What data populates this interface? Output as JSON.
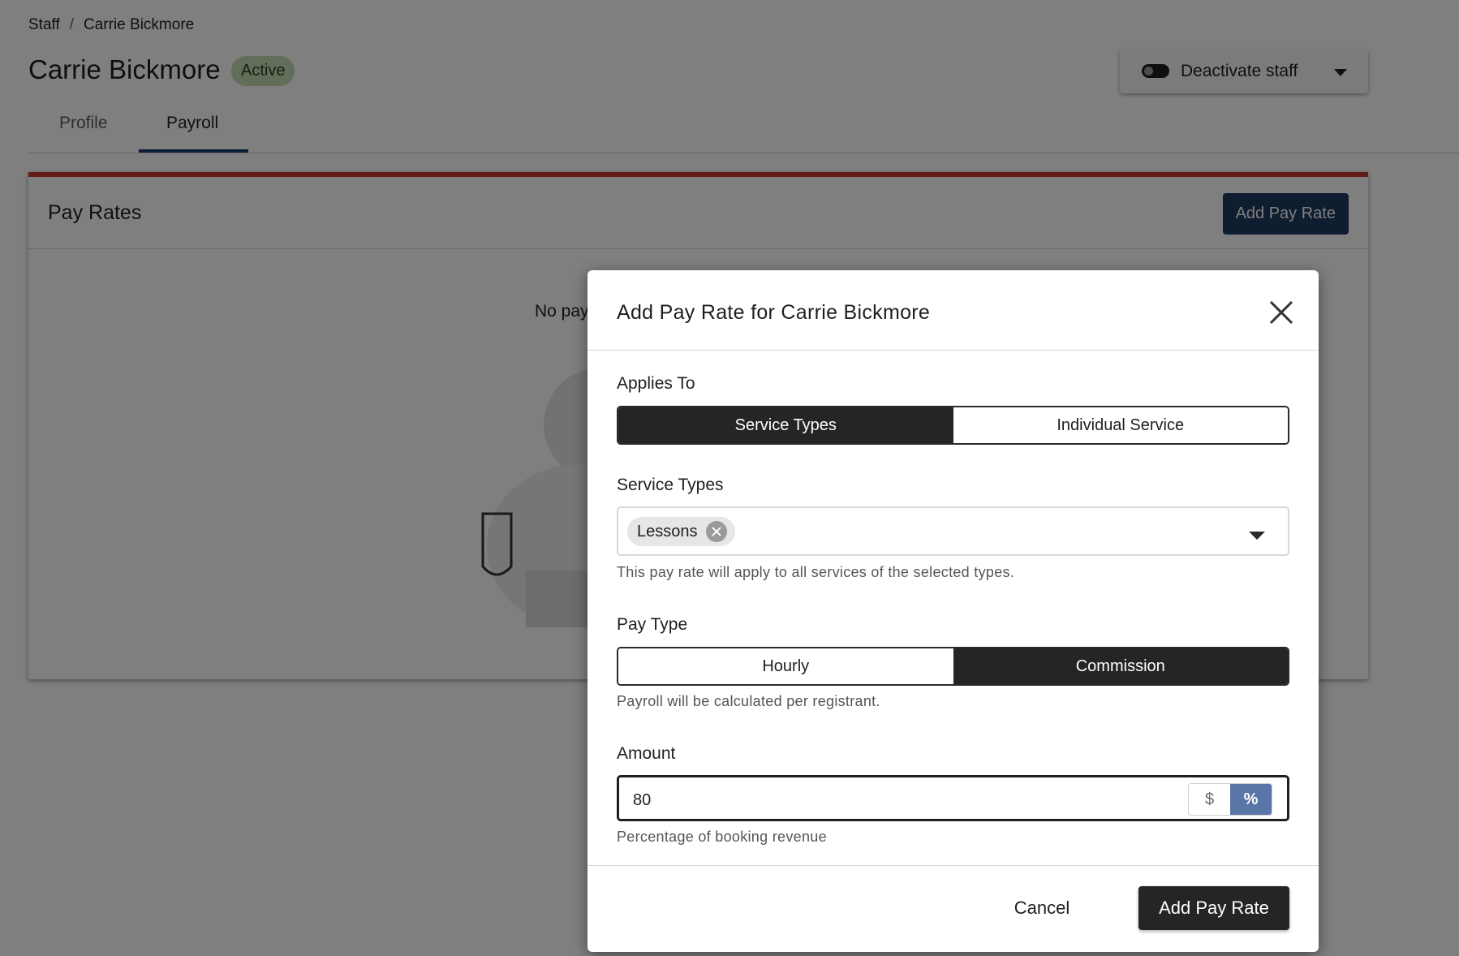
{
  "breadcrumb": {
    "root": "Staff",
    "separator": "/",
    "current": "Carrie Bickmore"
  },
  "header": {
    "title": "Carrie Bickmore",
    "status": "Active",
    "deactivate_label": "Deactivate staff"
  },
  "tabs": [
    {
      "label": "Profile"
    },
    {
      "label": "Payroll"
    }
  ],
  "pay_rates_card": {
    "title": "Pay Rates",
    "add_button": "Add Pay Rate",
    "empty_text": "No pay"
  },
  "modal": {
    "title": "Add Pay Rate for Carrie Bickmore",
    "applies_to": {
      "label": "Applies To",
      "options": [
        "Service Types",
        "Individual Service"
      ],
      "selected": "Service Types"
    },
    "service_types": {
      "label": "Service Types",
      "chips": [
        "Lessons"
      ],
      "help": "This pay rate will apply to all services of the selected types."
    },
    "pay_type": {
      "label": "Pay Type",
      "options": [
        "Hourly",
        "Commission"
      ],
      "selected": "Commission",
      "help": "Payroll will be calculated per registrant."
    },
    "amount": {
      "label": "Amount",
      "value": "80",
      "unit_options": [
        "$",
        "%"
      ],
      "selected_unit": "%",
      "help": "Percentage of booking revenue"
    },
    "cancel_label": "Cancel",
    "submit_label": "Add Pay Rate"
  },
  "colors": {
    "accent_navy": "#1e3a62",
    "active_badge": "#c7dcb4",
    "card_top_border": "#c43a2f",
    "unit_active": "#5a76a8",
    "dark_button": "#252525"
  }
}
